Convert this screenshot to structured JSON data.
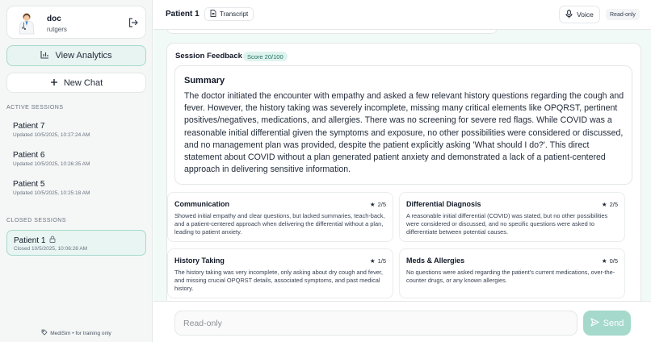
{
  "user": {
    "name": "doc",
    "org": "rutgers",
    "avatar_icon": "doctor-avatar-icon",
    "logout_icon": "logout-icon"
  },
  "sidebar": {
    "analytics_label": "View Analytics",
    "new_chat_label": "New Chat",
    "active_sessions_label": "ACTIVE SESSIONS",
    "active_sessions": [
      {
        "name": "Patient 7",
        "meta": "Updated 10/5/2025, 10:27:24 AM"
      },
      {
        "name": "Patient 6",
        "meta": "Updated 10/5/2025, 10:26:35 AM"
      },
      {
        "name": "Patient 5",
        "meta": "Updated 10/5/2025, 10:25:18 AM"
      }
    ],
    "closed_sessions_label": "CLOSED SESSIONS",
    "closed_sessions": [
      {
        "name": "Patient 1",
        "meta": "Closed 10/5/2025, 10:06:28 AM",
        "icon": "lock-icon"
      }
    ],
    "footer": "MediSim • for training only"
  },
  "header": {
    "title": "Patient 1",
    "transcript_label": "Transcript",
    "voice_label": "Voice",
    "readonly_label": "Read-only"
  },
  "feedback": {
    "title": "Session Feedback",
    "score": "Score 20/100",
    "summary_heading": "Summary",
    "summary_text": "The doctor initiated the encounter with empathy and asked a few relevant history questions regarding the cough and fever. However, the history taking was severely incomplete, missing many critical elements like OPQRST, pertinent positives/negatives, medications, and allergies. There was no screening for severe red flags. While COVID was a reasonable initial differential given the symptoms and exposure, no other possibilities were considered or discussed, and no management plan was provided, despite the patient explicitly asking 'What should I do?'. This direct statement about COVID without a plan generated patient anxiety and demonstrated a lack of a patient-centered approach in delivering sensitive information.",
    "cards": [
      {
        "title": "Communication",
        "score": "2/5",
        "text": "Showed initial empathy and clear questions, but lacked summaries, teach-back, and a patient-centered approach when delivering the differential without a plan, leading to patient anxiety."
      },
      {
        "title": "Differential Diagnosis",
        "score": "2/5",
        "text": "A reasonable initial differential (COVID) was stated, but no other possibilities were considered or discussed, and no specific questions were asked to differentiate between potential causes."
      },
      {
        "title": "History Taking",
        "score": "1/5",
        "text": "The history taking was very incomplete, only asking about dry cough and fever, and missing crucial OPQRST details, associated symptoms, and past medical history."
      },
      {
        "title": "Meds & Allergies",
        "score": "0/5",
        "text": "No questions were asked regarding the patient's current medications, over-the-counter drugs, or any known allergies."
      }
    ]
  },
  "composer": {
    "placeholder": "Read-only",
    "send_label": "Send"
  },
  "colors": {
    "accent": "#a5d9cc",
    "accent_light": "#e7f4f1",
    "main_bg": "#f2faf7"
  }
}
